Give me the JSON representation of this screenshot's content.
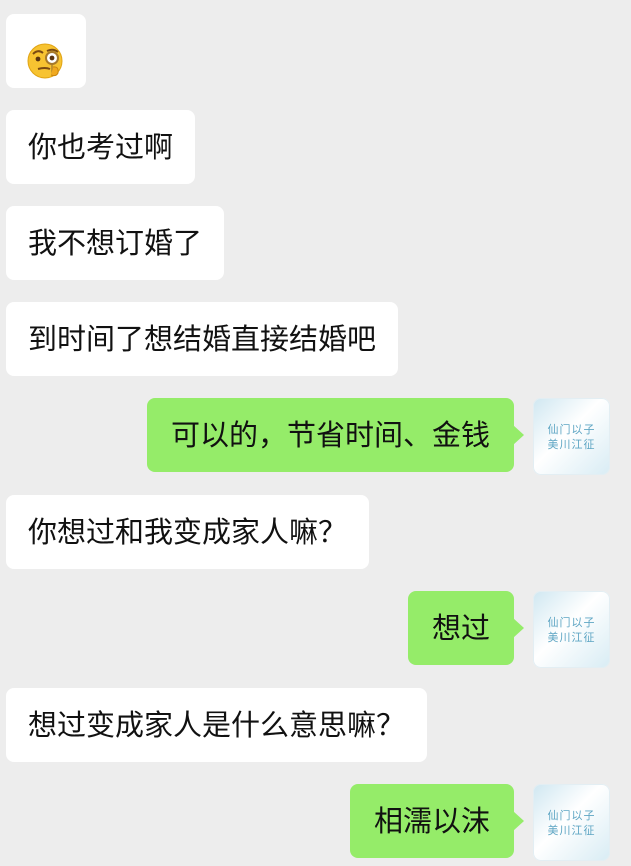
{
  "conversation": {
    "emoji_glyph": "🧐",
    "messages": [
      {
        "from": "them",
        "type": "emoji",
        "emoji": "face-with-monocle-icon"
      },
      {
        "from": "them",
        "text": "你也考过啊"
      },
      {
        "from": "them",
        "text": "我不想订婚了"
      },
      {
        "from": "them",
        "text": "到时间了想结婚直接结婚吧"
      },
      {
        "from": "me",
        "text": "可以的，节省时间、金钱"
      },
      {
        "from": "them",
        "text": "你想过和我变成家人嘛？"
      },
      {
        "from": "me",
        "text": "想过"
      },
      {
        "from": "them",
        "text": "想过变成家人是什么意思嘛？"
      },
      {
        "from": "me",
        "text": "相濡以沫"
      }
    ]
  },
  "avatar": {
    "line1": "仙门以子",
    "line2": "美川江征"
  },
  "colors": {
    "background": "#ededed",
    "incoming_bubble": "#ffffff",
    "outgoing_bubble": "#95ec69"
  }
}
